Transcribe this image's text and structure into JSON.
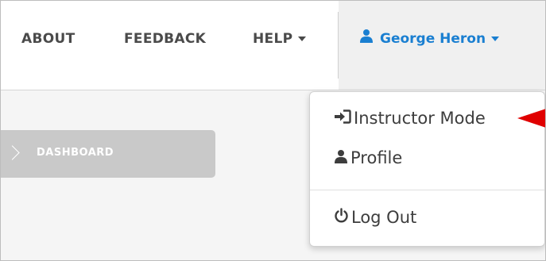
{
  "navbar": {
    "items": [
      {
        "label": "ABOUT"
      },
      {
        "label": "FEEDBACK"
      },
      {
        "label": "HELP"
      }
    ],
    "user": {
      "name": "George Heron"
    }
  },
  "sidebar": {
    "dashboard_label": "DASHBOARD"
  },
  "user_menu": {
    "items": [
      {
        "label": "Instructor Mode",
        "icon": "sign-in-icon"
      },
      {
        "label": "Profile",
        "icon": "user-icon"
      },
      {
        "label": "Log Out",
        "icon": "power-icon"
      }
    ]
  },
  "colors": {
    "accent": "#1a7fd1",
    "annotation_arrow": "#e00000",
    "nav_text": "#4a4a4a"
  }
}
